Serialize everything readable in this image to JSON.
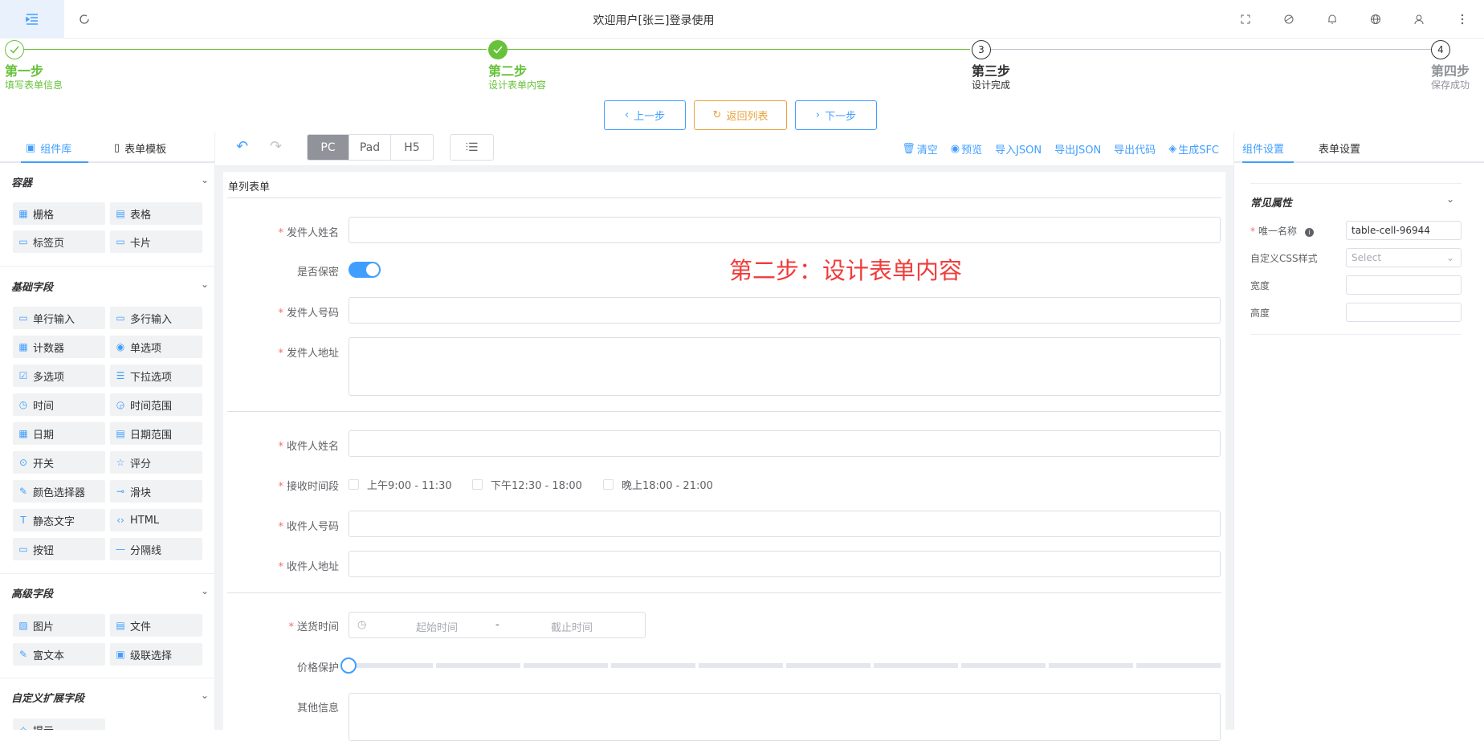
{
  "topbar": {
    "title": "欢迎用户[张三]登录使用",
    "icons": [
      "menu-fold-icon",
      "refresh-icon",
      "fullscreen-icon",
      "skin-icon",
      "bell-icon",
      "globe-icon",
      "user-icon",
      "more-icon"
    ]
  },
  "steps": [
    {
      "title": "第一步",
      "desc": "填写表单信息",
      "status": "finished"
    },
    {
      "title": "第二步",
      "desc": "设计表单内容",
      "status": "finished"
    },
    {
      "title": "第三步",
      "desc": "设计完成",
      "status": "current",
      "number": "3"
    },
    {
      "title": "第四步",
      "desc": "保存成功",
      "status": "waiting",
      "number": "4"
    }
  ],
  "step_buttons": {
    "prev": "上一步",
    "back": "返回列表",
    "next": "下一步"
  },
  "left": {
    "tabs": [
      "组件库",
      "表单模板"
    ],
    "sections": [
      {
        "title": "容器",
        "items": [
          "栅格",
          "表格",
          "标签页",
          "卡片"
        ]
      },
      {
        "title": "基础字段",
        "items": [
          "单行输入",
          "多行输入",
          "计数器",
          "单选项",
          "多选项",
          "下拉选项",
          "时间",
          "时间范围",
          "日期",
          "日期范围",
          "开关",
          "评分",
          "颜色选择器",
          "滑块",
          "静态文字",
          "HTML",
          "按钮",
          "分隔线"
        ]
      },
      {
        "title": "高级字段",
        "items": [
          "图片",
          "文件",
          "富文本",
          "级联选择"
        ]
      },
      {
        "title": "自定义扩展字段",
        "items": [
          "提示"
        ]
      }
    ]
  },
  "toolbar": {
    "devices": [
      "PC",
      "Pad",
      "H5"
    ],
    "links": [
      "清空",
      "预览",
      "导入JSON",
      "导出JSON",
      "导出代码",
      "生成SFC"
    ]
  },
  "form": {
    "title": "单列表单",
    "overlay_text": "第二步：设计表单内容",
    "fields": {
      "sender_name": "发件人姓名",
      "confidential": "是否保密",
      "sender_phone": "发件人号码",
      "sender_address": "发件人地址",
      "receiver_name": "收件人姓名",
      "receive_time": "接收时间段",
      "receiver_phone": "收件人号码",
      "receiver_address": "收件人地址",
      "delivery_time": "送货时间",
      "price_protect": "价格保护",
      "other_info": "其他信息"
    },
    "time_options": [
      "上午9:00 - 11:30",
      "下午12:30 - 18:00",
      "晚上18:00 - 21:00"
    ],
    "range_start": "起始时间",
    "range_sep": "-",
    "range_end": "截止时间",
    "switch_on": true,
    "slider_value": 0
  },
  "right": {
    "tabs": [
      "组件设置",
      "表单设置"
    ],
    "section": "常见属性",
    "props": {
      "unique_name_label": "唯一名称",
      "unique_name_value": "table-cell-96944",
      "css_label": "自定义CSS样式",
      "css_placeholder": "Select",
      "width_label": "宽度",
      "height_label": "高度"
    }
  },
  "colors": {
    "primary": "#409eff",
    "success": "#67c23a",
    "warning": "#e6a23c",
    "danger": "#f56c6c",
    "overlay": "#f03c3c"
  }
}
